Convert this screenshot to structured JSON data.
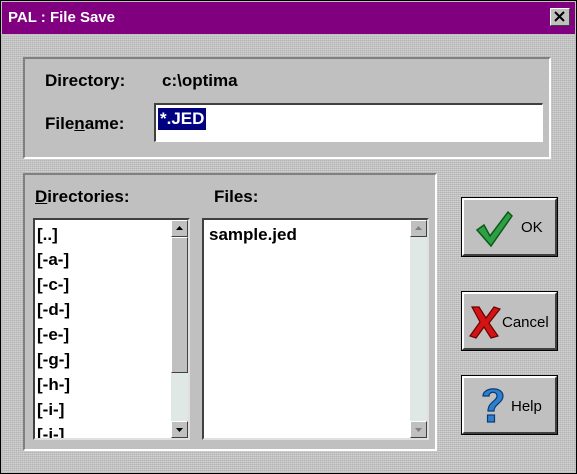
{
  "window": {
    "title": "PAL : File Save"
  },
  "directory": {
    "label": "Directory:",
    "value": "c:\\optima"
  },
  "filename": {
    "label_pre": "File",
    "label_key": "n",
    "label_post": "ame:",
    "value": "*.JED"
  },
  "directories": {
    "label_key": "D",
    "label_rest": "irectories:",
    "items": [
      "[..]",
      "[-a-]",
      "[-c-]",
      "[-d-]",
      "[-e-]",
      "[-g-]",
      "[-h-]",
      "[-i-]",
      "[-j-]"
    ]
  },
  "files": {
    "label": "Files:",
    "items": [
      "sample.jed"
    ]
  },
  "buttons": {
    "ok": "OK",
    "cancel": "Cancel",
    "help": "Help"
  },
  "icons": {
    "ok": "green-checkmark-icon",
    "cancel": "red-x-icon",
    "help": "blue-question-icon",
    "close": "close-icon"
  },
  "colors": {
    "titlebar": "#800080",
    "selection": "#000080",
    "face": "#c0c0c0"
  }
}
